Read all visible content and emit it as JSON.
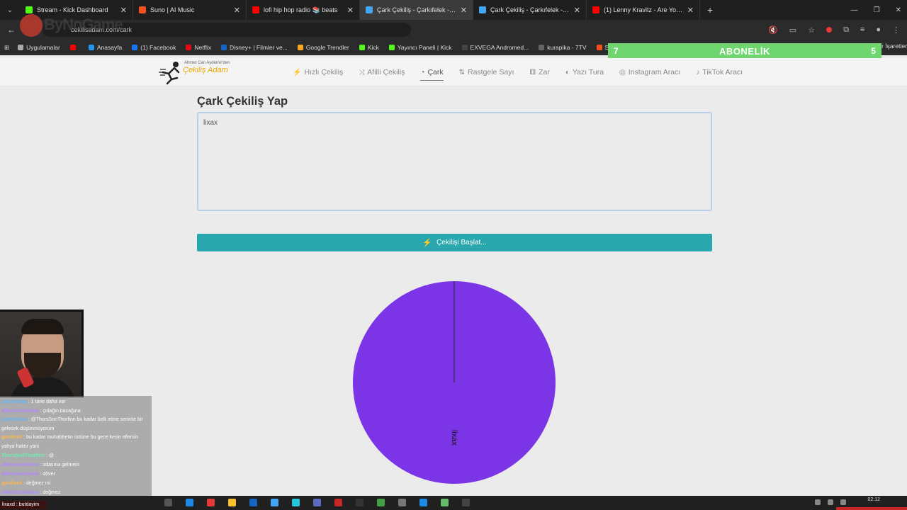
{
  "browser": {
    "tabs": [
      {
        "title": "Stream - Kick Dashboard",
        "color": "#53fc18",
        "active": false
      },
      {
        "title": "Suno | AI Music",
        "color": "#f4511e",
        "active": false
      },
      {
        "title": "lofi hip hop radio 📚 beats",
        "color": "#ff0000",
        "active": false
      },
      {
        "title": "Çark Çekiliş - Çarkıfelek - Hızlı Ç",
        "color": "#42a5f5",
        "active": true
      },
      {
        "title": "Çark Çekiliş - Çarkıfelek - Hızlı Ç",
        "color": "#42a5f5",
        "active": false
      },
      {
        "title": "(1) Lenny Kravitz - Are You Gon",
        "color": "#ff0000",
        "active": false
      }
    ],
    "address": "cekilisadam.com/cark",
    "overlay_brand": "ByNoGame"
  },
  "bookmarks": [
    {
      "label": "Uygulamalar",
      "color": "#aaaaaa"
    },
    {
      "label": "",
      "color": "#ff0000"
    },
    {
      "label": "Anasayfa",
      "color": "#2196f3"
    },
    {
      "label": "(1) Facebook",
      "color": "#1877f2"
    },
    {
      "label": "Netflix",
      "color": "#e50914"
    },
    {
      "label": "Disney+ | Filmler ve...",
      "color": "#1565c0"
    },
    {
      "label": "Google Trendler",
      "color": "#f9a825"
    },
    {
      "label": "Kick",
      "color": "#53fc18"
    },
    {
      "label": "Yayıncı Paneli | Kick",
      "color": "#53fc18"
    },
    {
      "label": "EXVEGA Andromed...",
      "color": "#444444"
    },
    {
      "label": "kurapika - 7TV",
      "color": "#666666"
    },
    {
      "label": "Su",
      "color": "#f4511e"
    }
  ],
  "bookmarks_trailing": "r İşaretler",
  "subscriber_bar": {
    "left": "7",
    "label": "ABONELİK",
    "right": "5",
    "color": "#6fd66f"
  },
  "site": {
    "brand_tag": "Ahmet Can Aydemir'den",
    "brand_name": "Çekiliş Adam",
    "nav": [
      {
        "label": "Hızlı Çekiliş",
        "icon": "bolt-icon",
        "active": false
      },
      {
        "label": "Afilli Çekiliş",
        "icon": "shuffle-icon",
        "active": false
      },
      {
        "label": "Çark",
        "icon": "wheel-icon",
        "active": true
      },
      {
        "label": "Rastgele Sayı",
        "icon": "sort-icon",
        "active": false
      },
      {
        "label": "Zar",
        "icon": "dice-icon",
        "active": false
      },
      {
        "label": "Yazı Tura",
        "icon": "coin-icon",
        "active": false
      },
      {
        "label": "Instagram Aracı",
        "icon": "instagram-icon",
        "active": false
      },
      {
        "label": "TikTok Aracı",
        "icon": "tiktok-icon",
        "active": false
      }
    ]
  },
  "main": {
    "heading": "Çark Çekiliş Yap",
    "entries_value": "lixax",
    "start_button": "Çekilişi Başlat..."
  },
  "wheel": {
    "segments": [
      {
        "label": "lixax",
        "color": "#7b35e6"
      }
    ]
  },
  "chat": [
    {
      "user": "janeevidaa",
      "color": "#64b5f6",
      "text": "1 tane daha var"
    },
    {
      "user": "altheravoldorna",
      "color": "#b388ff",
      "text": "çolağın bacağına"
    },
    {
      "user": "janeevidaa",
      "color": "#64b5f6",
      "text": "@ThorsSonThorfinn bu kadar belli etme seninle bir gelecek düşünmüyorum"
    },
    {
      "user": "gardiexd",
      "color": "#ffb74d",
      "text": "bu kadar muhabbetin üstüne bu gece kesin ellersin yahya haktır yani"
    },
    {
      "user": "ThorsSonThorfinn",
      "color": "#69f0ae",
      "text": "@"
    },
    {
      "user": "altheravoldorna",
      "color": "#b388ff",
      "text": "odasına gelmem"
    },
    {
      "user": "altheravoldorna",
      "color": "#b388ff",
      "text": "döver"
    },
    {
      "user": "gardiexd",
      "color": "#ffb74d",
      "text": "değmez mi"
    },
    {
      "user": "altheravoldorna",
      "color": "#b388ff",
      "text": "değmez"
    }
  ],
  "lower_bar": "lixaxd : butdayim",
  "clock": {
    "time": "02:12",
    "date": ""
  }
}
